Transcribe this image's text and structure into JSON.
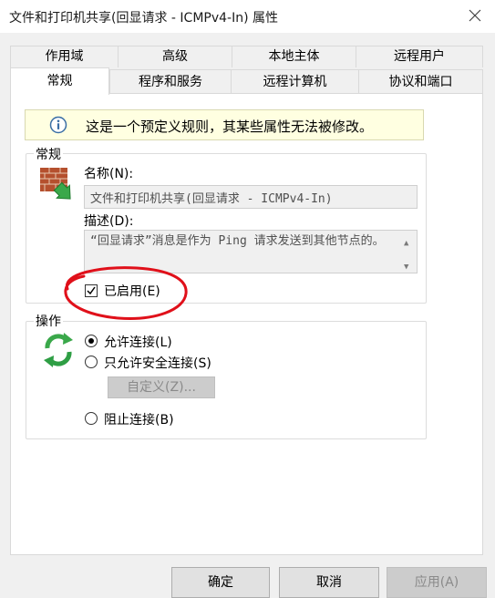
{
  "window": {
    "title": "文件和打印机共享(回显请求 - ICMPv4-In) 属性"
  },
  "tabs_back": [
    "作用域",
    "高级",
    "本地主体",
    "远程用户"
  ],
  "tabs_front": [
    "常规",
    "程序和服务",
    "远程计算机",
    "协议和端口"
  ],
  "info": {
    "text": "这是一个预定义规则，其某些属性无法被修改。"
  },
  "general": {
    "group_label": "常规",
    "name_label": "名称(N):",
    "name_value": "文件和打印机共享(回显请求 - ICMPv4-In)",
    "desc_label": "描述(D):",
    "desc_value": "“回显请求”消息是作为 Ping 请求发送到其他节点的。",
    "enabled_label": "已启用(E)",
    "enabled": true
  },
  "action": {
    "group_label": "操作",
    "allow_label": "允许连接(L)",
    "allow_secure_label": "只允许安全连接(S)",
    "customize_label": "自定义(Z)...",
    "block_label": "阻止连接(B)",
    "selected": "allow"
  },
  "buttons": {
    "ok": "确定",
    "cancel": "取消",
    "apply": "应用(A)"
  },
  "annotation": {
    "color": "#e0101a"
  }
}
